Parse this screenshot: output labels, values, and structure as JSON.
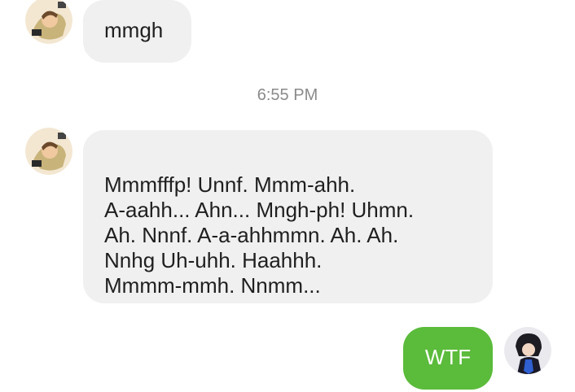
{
  "conversation": {
    "messages": [
      {
        "sender": "contact",
        "text": "mmgh"
      },
      {
        "sender": "contact",
        "text": "Mmmfffp! Unnf. Mmm-ahh.\nA-aahh... Ahn... Mngh-ph! Uhmn.\nAh. Nnnf. A-a-ahhmmn. Ah. Ah.\nNnhg Uh-uhh. Haahhh.\nMmmm-mmh. Nnmm..."
      },
      {
        "sender": "me",
        "text": "WTF"
      }
    ],
    "timestamp": "6:55 PM"
  },
  "colors": {
    "incoming_bubble": "#f0f0f0",
    "outgoing_bubble": "#5bbb3b",
    "timestamp_text": "#8a8a8a"
  },
  "icons": {
    "contact_avatar": "contact-avatar-icon",
    "user_avatar": "user-avatar-icon"
  }
}
